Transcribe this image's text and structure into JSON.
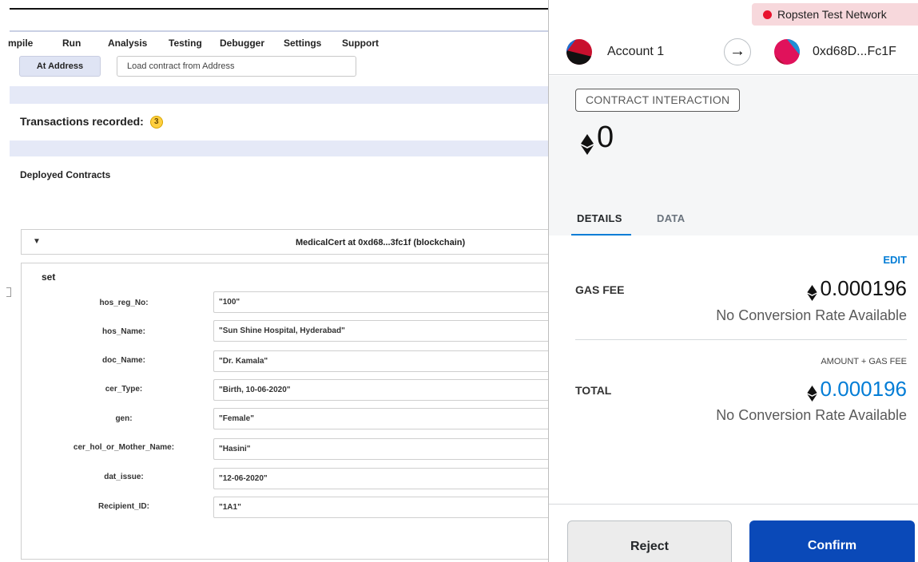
{
  "remix": {
    "menu": [
      "mpile",
      "Run",
      "Analysis",
      "Testing",
      "Debugger",
      "Settings",
      "Support"
    ],
    "at_address_label": "At Address",
    "load_contract_placeholder": "Load contract from Address",
    "transactions_recorded_label": "Transactions recorded:",
    "transactions_count": "3",
    "deployed_contracts_title": "Deployed Contracts",
    "contract_name": "MedicalCert at 0xd68...3fc1f (blockchain)",
    "function_name": "set",
    "params": [
      {
        "label": "hos_reg_No:",
        "value": "\"100\""
      },
      {
        "label": "hos_Name:",
        "value": "\"Sun Shine Hospital, Hyderabad\""
      },
      {
        "label": "doc_Name:",
        "value": "\"Dr. Kamala\""
      },
      {
        "label": "cer_Type:",
        "value": "\"Birth, 10-06-2020\""
      },
      {
        "label": "gen:",
        "value": "\"Female\""
      },
      {
        "label": "cer_hol_or_Mother_Name:",
        "value": "\"Hasini\""
      },
      {
        "label": "dat_issue:",
        "value": "\"12-06-2020\""
      },
      {
        "label": "Recipient_ID:",
        "value": "\"1A1\""
      }
    ]
  },
  "metamask": {
    "network": "Ropsten Test Network",
    "network_color": "#e8122d",
    "from_account": "Account 1",
    "to_address": "0xd68D...Fc1F",
    "tag": "CONTRACT INTERACTION",
    "amount": "0",
    "tabs": [
      "DETAILS",
      "DATA"
    ],
    "edit_label": "EDIT",
    "gas_fee_label": "GAS FEE",
    "gas_fee_value": "0.000196",
    "no_conversion": "No Conversion Rate Available",
    "amount_plus_gas_label": "AMOUNT + GAS FEE",
    "total_label": "TOTAL",
    "total_value": "0.000196",
    "reject_label": "Reject",
    "confirm_label": "Confirm",
    "accent_color": "#037dd6",
    "confirm_color": "#0a49b8"
  }
}
